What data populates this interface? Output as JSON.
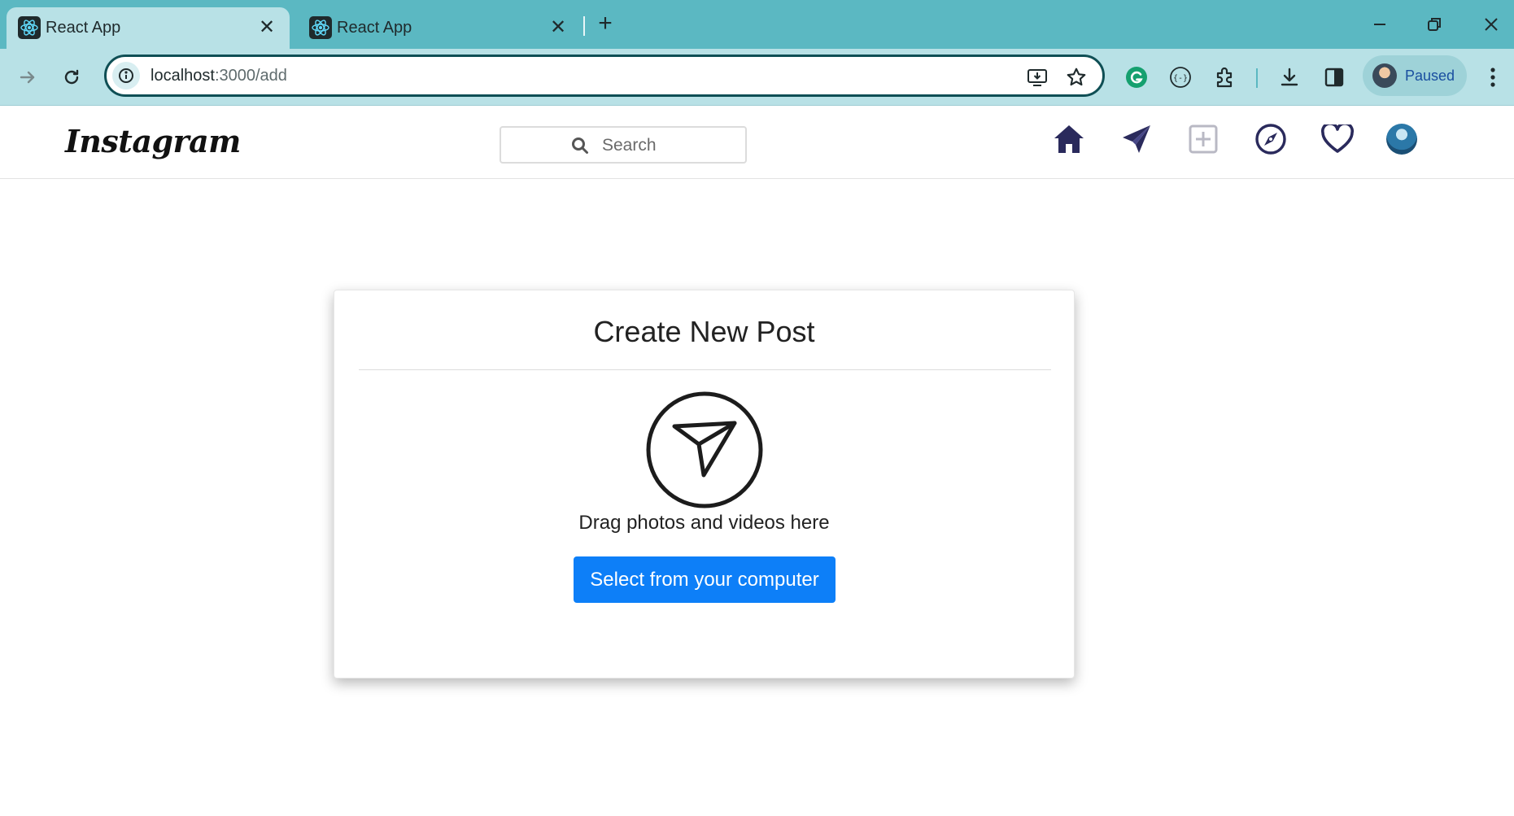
{
  "browser": {
    "tabs": [
      {
        "title": "React App",
        "active": true
      },
      {
        "title": "React App",
        "active": false
      }
    ],
    "address": {
      "host": "localhost",
      "path": ":3000/add"
    },
    "profile_status": "Paused",
    "colors": {
      "tabbar": "#5bb8c2",
      "toolbar": "#b8e1e6",
      "omnibox_border": "#0f4f55"
    }
  },
  "app": {
    "logo_text": "Instagram",
    "search": {
      "placeholder": "Search"
    },
    "nav_icons": [
      "home-icon",
      "send-icon",
      "add-post-icon",
      "explore-icon",
      "heart-icon",
      "profile-avatar"
    ],
    "colors": {
      "nav_icon": "#2a2a5c",
      "accent_button": "#0d7ff8"
    }
  },
  "create_post": {
    "title": "Create New Post",
    "drag_text": "Drag photos and videos here",
    "select_button_label": "Select from your computer"
  }
}
